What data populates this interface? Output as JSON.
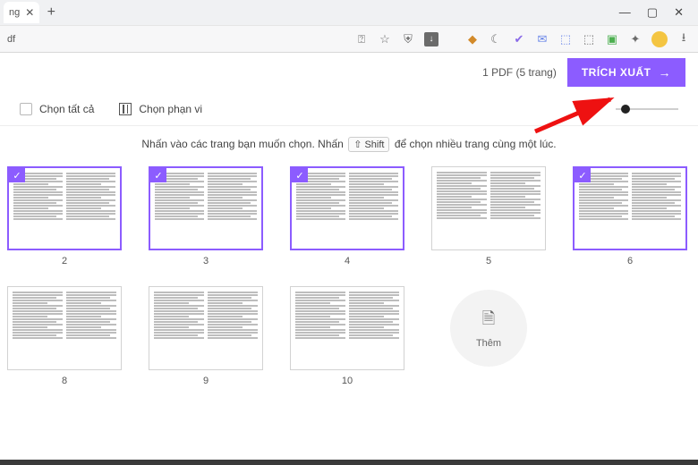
{
  "window": {
    "min": "—",
    "max": "▢",
    "close": "✕"
  },
  "tab": {
    "suffix": "ng",
    "close": "✕",
    "new": "+"
  },
  "address": {
    "label": "df"
  },
  "toolbar_icons": {
    "translate": "⍰",
    "star": "☆",
    "shield": "⛨",
    "download_sq": "↓",
    "diamond": "◆",
    "moon": "☾",
    "check": "✔",
    "msg": "✉",
    "cam": "⬚",
    "ext1": "⬚",
    "ext2": "▣",
    "puzzle": "✦",
    "face": "☺",
    "dl": "⭳"
  },
  "header": {
    "pdf_count": "1 PDF (5 trang)",
    "extract_label": "TRÍCH XUẤT",
    "arrow": "→"
  },
  "options": {
    "select_all": "Chọn tất cả",
    "select_range": "Chọn phạn vi"
  },
  "instruction": {
    "pre": "Nhấn vào các trang bạn muốn chọn. Nhấn",
    "key": "⇧ Shift",
    "post": "để chọn nhiều trang cùng một lúc."
  },
  "pages": [
    {
      "num": "2",
      "selected": true
    },
    {
      "num": "3",
      "selected": true
    },
    {
      "num": "4",
      "selected": true
    },
    {
      "num": "5",
      "selected": false
    },
    {
      "num": "6",
      "selected": true
    },
    {
      "num": "8",
      "selected": false
    },
    {
      "num": "9",
      "selected": false
    },
    {
      "num": "10",
      "selected": false
    }
  ],
  "add": {
    "label": "Thêm",
    "icon": "🗎"
  },
  "check": "✓"
}
